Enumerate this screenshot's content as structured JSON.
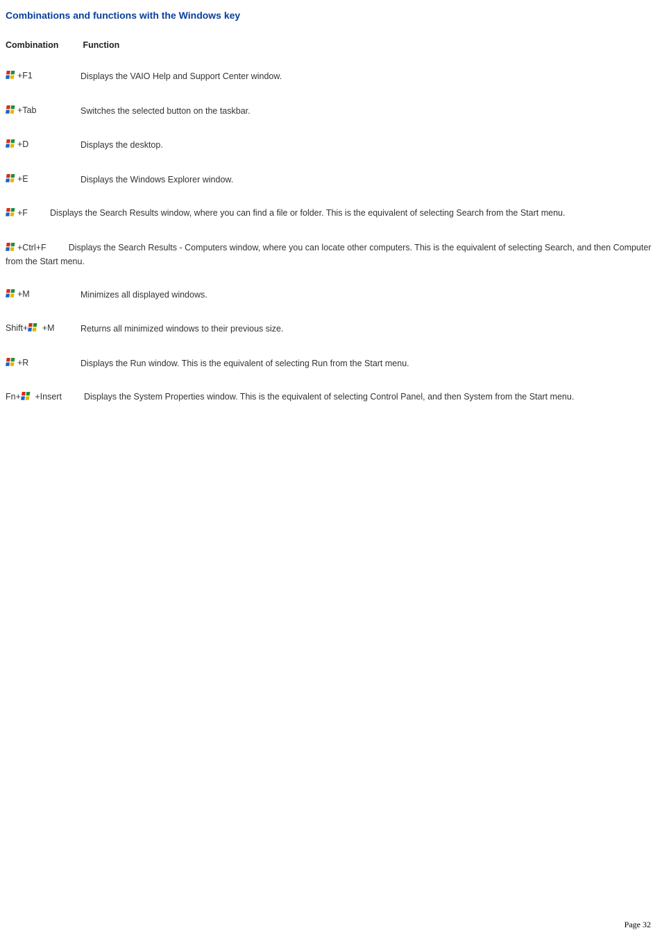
{
  "title": "Combinations and functions with the Windows key",
  "header": {
    "combination": "Combination",
    "function": "Function"
  },
  "rows": [
    {
      "combo_prefix": "",
      "has_icon": true,
      "combo_suffix": "+F1",
      "function": "Displays the VAIO Help and Support Center window.",
      "tabular": true
    },
    {
      "combo_prefix": "",
      "has_icon": true,
      "combo_suffix": "+Tab",
      "function": "Switches the selected button on the taskbar.",
      "tabular": true
    },
    {
      "combo_prefix": "",
      "has_icon": true,
      "combo_suffix": "+D",
      "function": "Displays the desktop.",
      "tabular": true
    },
    {
      "combo_prefix": "",
      "has_icon": true,
      "combo_suffix": "+E",
      "function": "Displays the Windows Explorer window.",
      "tabular": true
    },
    {
      "combo_prefix": "",
      "has_icon": true,
      "combo_suffix": "+F",
      "function": "Displays the Search Results window, where you can find a file or folder. This is the equivalent of selecting Search from the Start menu.",
      "tabular": false
    },
    {
      "combo_prefix": "",
      "has_icon": true,
      "combo_suffix": "+Ctrl+F",
      "function": "Displays the Search Results - Computers window, where you can locate other computers. This is the equivalent of selecting Search, and then Computer from the Start menu.",
      "tabular": false
    },
    {
      "combo_prefix": "",
      "has_icon": true,
      "combo_suffix": "+M",
      "function": "Minimizes all displayed windows.",
      "tabular": true
    },
    {
      "combo_prefix": "Shift+",
      "has_icon": true,
      "combo_suffix": " +M",
      "function": "Returns all minimized windows to their previous size.",
      "tabular": true
    },
    {
      "combo_prefix": "",
      "has_icon": true,
      "combo_suffix": "+R",
      "function": "Displays the Run window. This is the equivalent of selecting Run from the Start menu.",
      "tabular": true
    },
    {
      "combo_prefix": "Fn+",
      "has_icon": true,
      "combo_suffix": " +Insert",
      "function": "Displays the System Properties window. This is the equivalent of selecting Control Panel, and then System from the Start menu.",
      "tabular": false
    }
  ],
  "page_label": "Page 32"
}
